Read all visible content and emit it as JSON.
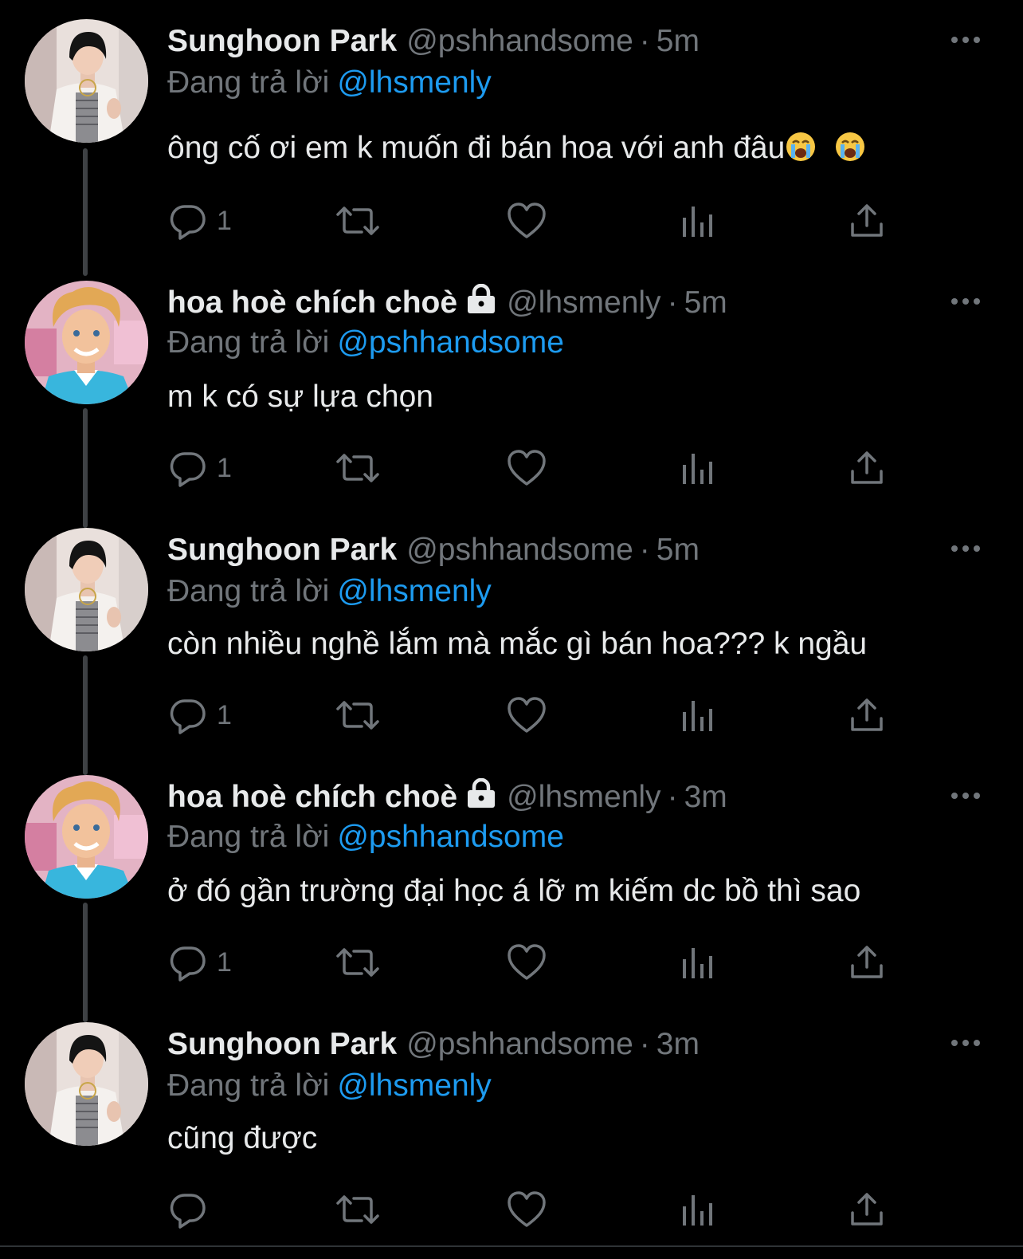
{
  "colors": {
    "background": "#000000",
    "text": "#e7e9ea",
    "muted": "#71767b",
    "link": "#1d9bf0",
    "thread_line": "#3e4144"
  },
  "icons": {
    "reply": "reply-icon",
    "retweet": "retweet-icon",
    "like": "heart-icon",
    "views": "views-icon",
    "share": "share-icon",
    "more": "more-icon",
    "lock": "lock-icon",
    "emoji": "loudly-crying-face-emoji"
  },
  "tweets": [
    {
      "display_name": "Sunghoon Park",
      "handle": "@pshhandsome",
      "separator": "·",
      "time": "5m",
      "replying_prefix": "Đang trả lời",
      "replying_to": "@lhsmenly",
      "text": "ông cố ơi em k muốn đi bán hoa với anh đâu",
      "emoji_suffix": "😭 😭",
      "reply_count": "1",
      "avatar": "boy"
    },
    {
      "display_name": "hoa hoè chích choè",
      "handle": "@lhsmenly",
      "separator": "·",
      "time": "5m",
      "replying_prefix": "Đang trả lời",
      "replying_to": "@pshhandsome",
      "text": "m k có sự lựa chọn",
      "reply_count": "1",
      "avatar": "doll"
    },
    {
      "display_name": "Sunghoon Park",
      "handle": "@pshhandsome",
      "separator": "·",
      "time": "5m",
      "replying_prefix": "Đang trả lời",
      "replying_to": "@lhsmenly",
      "text": "còn nhiều nghề lắm mà mắc gì bán hoa??? k ngầu",
      "reply_count": "1",
      "avatar": "boy"
    },
    {
      "display_name": "hoa hoè chích choè",
      "handle": "@lhsmenly",
      "separator": "·",
      "time": "3m",
      "replying_prefix": "Đang trả lời",
      "replying_to": "@pshhandsome",
      "text": "ở đó gần trường đại học á lỡ m kiếm dc bồ thì sao",
      "reply_count": "1",
      "avatar": "doll"
    },
    {
      "display_name": "Sunghoon Park",
      "handle": "@pshhandsome",
      "separator": "·",
      "time": "3m",
      "replying_prefix": "Đang trả lời",
      "replying_to": "@lhsmenly",
      "text": "cũng được",
      "reply_count": "",
      "avatar": "boy"
    }
  ]
}
